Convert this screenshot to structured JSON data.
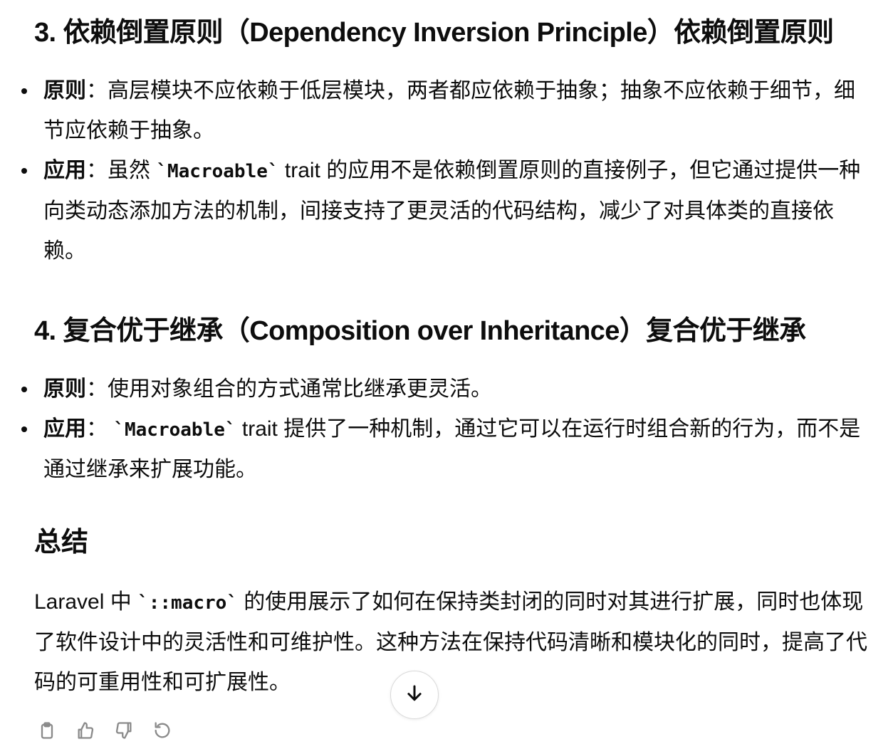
{
  "sections": [
    {
      "heading": "3. 依赖倒置原则（Dependency Inversion Principle）依赖倒置原则",
      "principle_label": "原则",
      "principle_text": "：高层模块不应依赖于低层模块，两者都应依赖于抽象；抽象不应依赖于细节，细节应依赖于抽象。",
      "application_label": "应用",
      "application_prefix": "：虽然 ",
      "application_code": "`Macroable`",
      "application_suffix": " trait 的应用不是依赖倒置原则的直接例子，但它通过提供一种向类动态添加方法的机制，间接支持了更灵活的代码结构，减少了对具体类的直接依赖。"
    },
    {
      "heading": "4. 复合优于继承（Composition over Inheritance）复合优于继承",
      "principle_label": "原则",
      "principle_text": "：使用对象组合的方式通常比继承更灵活。",
      "application_label": "应用",
      "application_prefix": "： ",
      "application_code": "`Macroable`",
      "application_suffix": " trait 提供了一种机制，通过它可以在运行时组合新的行为，而不是通过继承来扩展功能。"
    }
  ],
  "summary": {
    "heading": "总结",
    "prefix": "Laravel 中 ",
    "code": "`::macro`",
    "suffix": " 的使用展示了如何在保持类封闭的同时对其进行扩展，同时也体现了软件设计中的灵活性和可维护性。这种方法在保持代码清晰和模块化的同时，提高了代码的可重用性和可扩展性。"
  },
  "icons": {
    "scroll_down": "arrow-down-icon",
    "actions": [
      "copy-icon",
      "thumbs-up-icon",
      "thumbs-down-icon",
      "regenerate-icon"
    ]
  },
  "colors": {
    "text": "#0d0d0d",
    "icon_muted": "#8a8a8a",
    "button_border": "#d9d9d9"
  }
}
